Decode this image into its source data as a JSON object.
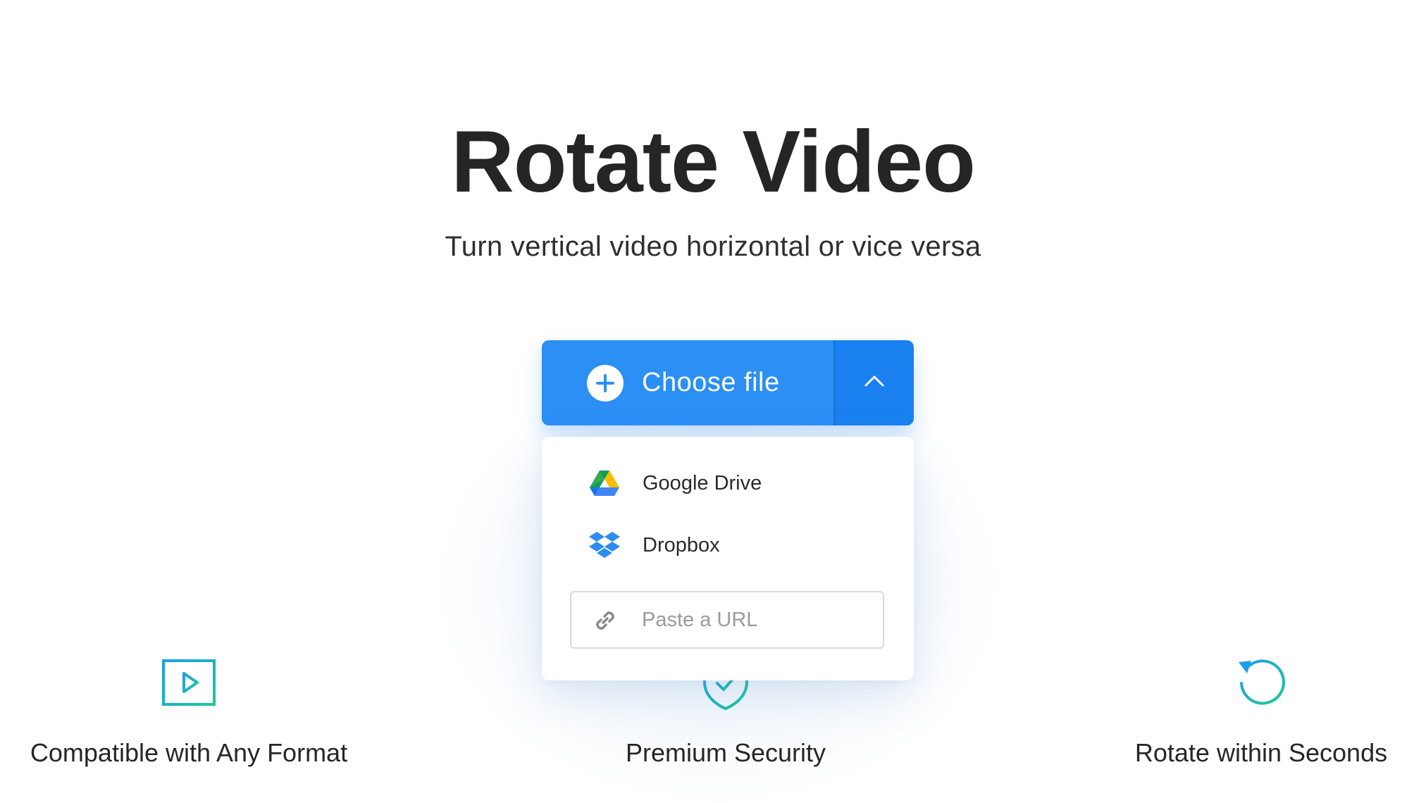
{
  "header": {
    "title": "Rotate Video",
    "subtitle": "Turn vertical video horizontal or vice versa"
  },
  "upload": {
    "choose_label": "Choose file",
    "plus_icon": "plus-icon",
    "toggle_icon": "chevron-up-icon",
    "accent_color": "#2b8ff4",
    "dropdown": {
      "items": [
        {
          "label": "Google Drive",
          "icon": "google-drive-icon"
        },
        {
          "label": "Dropbox",
          "icon": "dropbox-icon"
        }
      ],
      "url_placeholder": "Paste a URL",
      "url_value": "",
      "url_icon": "link-icon"
    }
  },
  "features": [
    {
      "label": "Compatible with Any Format",
      "icon": "video-file-icon"
    },
    {
      "label": "Premium Security",
      "icon": "shield-check-icon"
    },
    {
      "label": "Rotate within Seconds",
      "icon": "rotate-icon"
    }
  ]
}
